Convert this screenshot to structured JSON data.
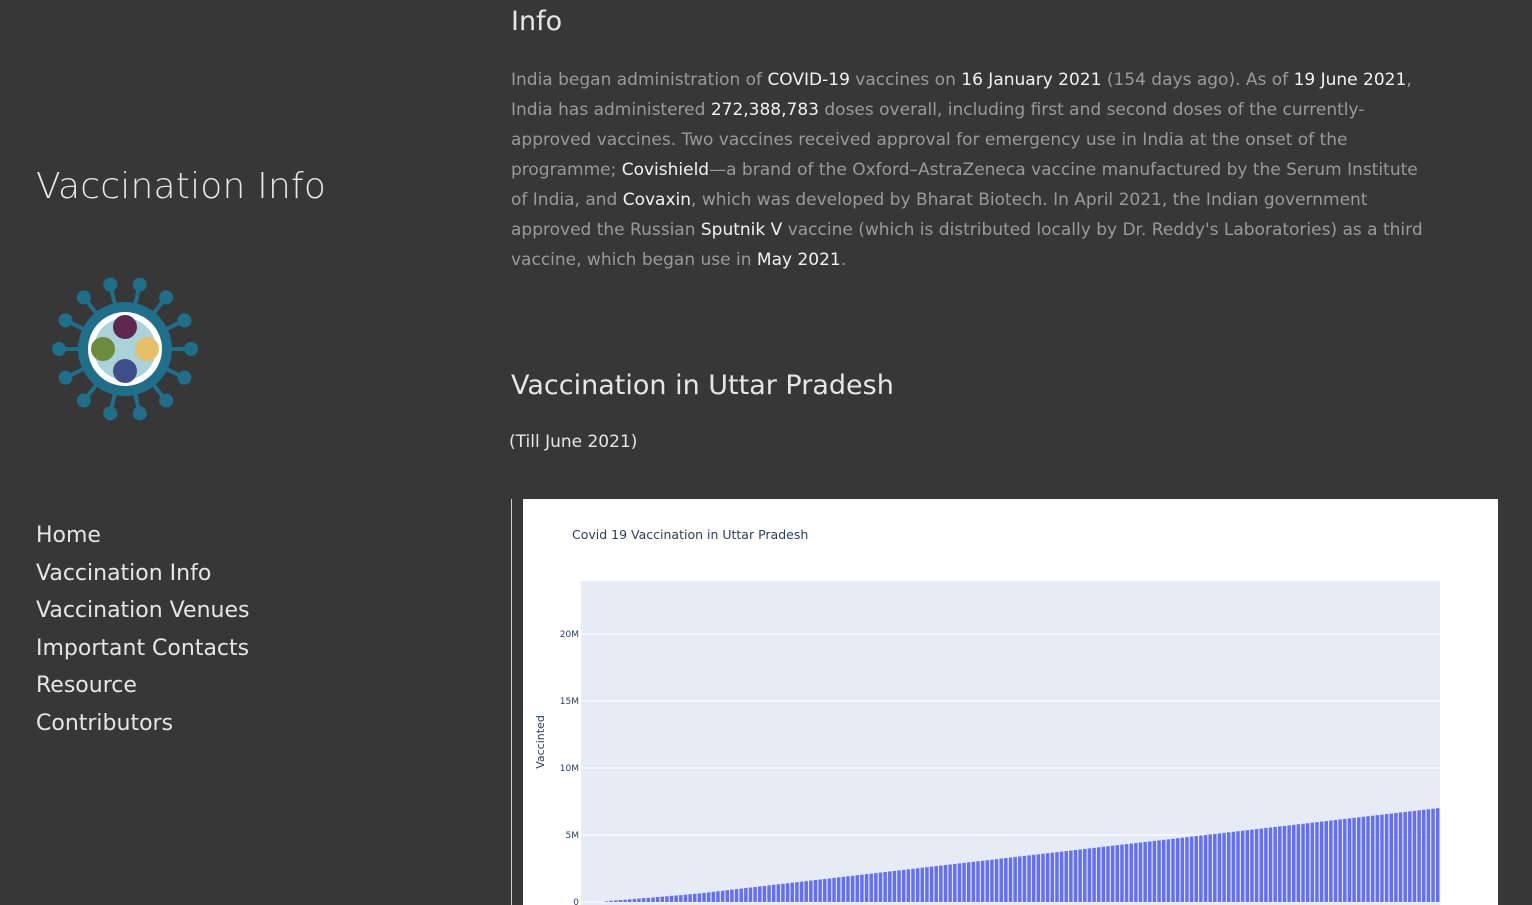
{
  "sidebar": {
    "site_title": "Vaccination Info",
    "logo_icon": "vaccine-virus-logo-icon",
    "nav": [
      {
        "label": "Home"
      },
      {
        "label": "Vaccination Info"
      },
      {
        "label": "Vaccination Venues"
      },
      {
        "label": "Important Contacts"
      },
      {
        "label": "Resource"
      },
      {
        "label": "Contributors"
      }
    ]
  },
  "main": {
    "info_heading": "Info",
    "info_parts": [
      {
        "text": "India began administration of ",
        "hl": false
      },
      {
        "text": "COVID-19",
        "hl": true
      },
      {
        "text": " vaccines on ",
        "hl": false
      },
      {
        "text": "16 January 2021",
        "hl": true
      },
      {
        "text": " (154 days ago). As of ",
        "hl": false
      },
      {
        "text": "19 June 2021",
        "hl": true
      },
      {
        "text": ", India has administered ",
        "hl": false
      },
      {
        "text": "272,388,783",
        "hl": true
      },
      {
        "text": " doses overall, including first and second doses of the currently-approved vaccines. Two vaccines received approval for emergency use in India at the onset of the programme; ",
        "hl": false
      },
      {
        "text": "Covishield",
        "hl": true
      },
      {
        "text": "—a brand of the Oxford–AstraZeneca vaccine manufactured by the Serum Institute of India, and ",
        "hl": false
      },
      {
        "text": "Covaxin",
        "hl": true
      },
      {
        "text": ", which was developed by Bharat Biotech. In April 2021, the Indian government approved the Russian ",
        "hl": false
      },
      {
        "text": "Sputnik V",
        "hl": true
      },
      {
        "text": " vaccine (which is distributed locally by Dr. Reddy's Laboratories) as a third vaccine, which began use in ",
        "hl": false
      },
      {
        "text": "May 2021",
        "hl": true
      },
      {
        "text": ".",
        "hl": false
      }
    ],
    "up_heading": "Vaccination in Uttar Pradesh",
    "till_note": "(Till June 2021)"
  },
  "colors": {
    "background": "#373737",
    "bar": "#636efa",
    "plot_bg": "#e5ecf6",
    "text_bright": "#f2f2f2",
    "text_dim": "#9a9a9a"
  },
  "chart_data": {
    "type": "bar",
    "title": "Covid 19 Vaccination in Uttar Pradesh",
    "xlabel": "",
    "ylabel": "Vaccinted",
    "ylim": [
      0,
      24000000
    ],
    "yticks": [
      {
        "value": 0,
        "label": "0"
      },
      {
        "value": 5000000,
        "label": "5M"
      },
      {
        "value": 10000000,
        "label": "10M"
      },
      {
        "value": 15000000,
        "label": "15M"
      },
      {
        "value": 20000000,
        "label": "20M"
      }
    ],
    "grid": true,
    "values": [
      0,
      0,
      0,
      0,
      0,
      50000,
      90000,
      120000,
      150000,
      170000,
      200000,
      230000,
      260000,
      290000,
      310000,
      340000,
      370000,
      400000,
      430000,
      460000,
      490000,
      510000,
      550000,
      580000,
      610000,
      640000,
      680000,
      720000,
      760000,
      800000,
      840000,
      880000,
      920000,
      960000,
      1000000,
      1040000,
      1080000,
      1120000,
      1160000,
      1200000,
      1240000,
      1280000,
      1320000,
      1360000,
      1400000,
      1440000,
      1480000,
      1520000,
      1560000,
      1600000,
      1640000,
      1680000,
      1720000,
      1760000,
      1800000,
      1840000,
      1880000,
      1920000,
      1960000,
      2000000,
      2040000,
      2080000,
      2120000,
      2160000,
      2200000,
      2240000,
      2280000,
      2320000,
      2360000,
      2400000,
      2440000,
      2480000,
      2520000,
      2560000,
      2600000,
      2640000,
      2680000,
      2720000,
      2760000,
      2800000,
      2840000,
      2880000,
      2920000,
      2960000,
      3000000,
      3040000,
      3080000,
      3120000,
      3160000,
      3200000,
      3240000,
      3280000,
      3320000,
      3360000,
      3400000,
      3440000,
      3480000,
      3520000,
      3560000,
      3600000,
      3640000,
      3680000,
      3720000,
      3760000,
      3800000,
      3840000,
      3880000,
      3920000,
      3960000,
      4000000,
      4040000,
      4080000,
      4120000,
      4160000,
      4200000,
      4240000,
      4280000,
      4320000,
      4360000,
      4400000,
      4440000,
      4480000,
      4520000,
      4560000,
      4600000,
      4640000,
      4680000,
      4720000,
      4760000,
      4800000,
      4840000,
      4880000,
      4920000,
      4960000,
      5000000,
      5040000,
      5080000,
      5120000,
      5160000,
      5200000,
      5240000,
      5280000,
      5320000,
      5360000,
      5400000,
      5440000,
      5480000,
      5520000,
      5560000,
      5600000,
      5640000,
      5680000,
      5720000,
      5760000,
      5800000,
      5840000,
      5880000,
      5920000,
      5960000,
      6000000,
      6040000,
      6080000,
      6120000,
      6160000,
      6200000,
      6240000,
      6280000,
      6320000,
      6360000,
      6400000,
      6440000,
      6480000,
      6520000,
      6560000,
      6600000,
      6640000,
      6680000,
      6720000,
      6760000,
      6800000,
      6840000,
      6880000,
      6920000,
      6960000,
      7000000
    ]
  }
}
